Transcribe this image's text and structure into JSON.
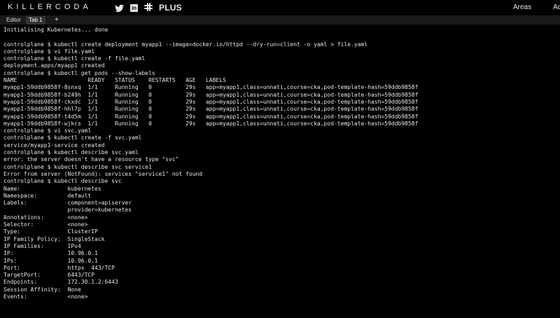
{
  "header": {
    "logo_text": "KILLERCODA",
    "social_icons": [
      "twitter-icon",
      "linkedin-icon",
      "slack-icon"
    ],
    "plus_label": "PLUS",
    "nav_areas": "Areas",
    "nav_partial": "Ac"
  },
  "tabs": {
    "editor_label": "Editor",
    "tab1_label": "Tab 1",
    "add_label": "+"
  },
  "terminal": {
    "lines": [
      "Initialising Kubernetes... done",
      "",
      "controlplane $ kubectl create deployment myapp1 --image=docker.io/httpd --dry-run=client -o yaml > file.yaml",
      "controlplane $ vi file.yaml",
      "controlplane $ kubectl create -f file.yaml",
      "deployment.apps/myapp1 created",
      "controlplane $ kubectl get pods --show-labels",
      "NAME                     READY   STATUS    RESTARTS   AGE   LABELS",
      "myapp1-59ddb9858f-8snxq  1/1     Running   0          29s   app=myapp1,class=unnati,course=cka,pod-template-hash=59ddb9858f",
      "myapp1-59ddb9858f-b249h  1/1     Running   0          29s   app=myapp1,class=unnati,course=cka,pod-template-hash=59ddb9858f",
      "myapp1-59ddb9858f-ckxdc  1/1     Running   0          29s   app=myapp1,class=unnati,course=cka,pod-template-hash=59ddb9858f",
      "myapp1-59ddb9858f-hhl7p  1/1     Running   0          29s   app=myapp1,class=unnati,course=cka,pod-template-hash=59ddb9858f",
      "myapp1-59ddb9858f-t4d5m  1/1     Running   0          29s   app=myapp1,class=unnati,course=cka,pod-template-hash=59ddb9858f",
      "myapp1-59ddb9858f-wjkcs  1/1     Running   0          29s   app=myapp1,class=unnati,course=cka,pod-template-hash=59ddb9858f",
      "controlplane $ vi svc.yaml",
      "controlplane $ kubectl create -f svc.yaml",
      "service/myapp1-service created",
      "controlplane $ kubectl describe svc.yaml",
      "error: the server doesn't have a resource type \"svc\"",
      "controlplane $ kubectl describe svc service1",
      "Error from server (NotFound): services \"service1\" not found",
      "controlplane $ kubectl describe svc",
      "Name:              kubernetes",
      "Namespace:         default",
      "Labels:            component=apiserver",
      "                   provider=kubernetes",
      "Annotations:       <none>",
      "Selector:          <none>",
      "Type:              ClusterIP",
      "IP Family Policy:  SingleStack",
      "IP Families:       IPv4",
      "IP:                10.96.0.1",
      "IPs:               10.96.0.1",
      "Port:              https  443/TCP",
      "TargetPort:        6443/TCP",
      "Endpoints:         172.30.1.2:6443",
      "Session Affinity:  None",
      "Events:            <none>"
    ]
  }
}
